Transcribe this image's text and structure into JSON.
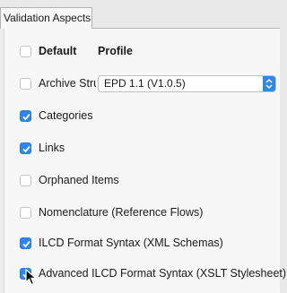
{
  "tab": {
    "label": "Validation Aspects"
  },
  "header": {
    "default_label": "Default",
    "profile_label": "Profile"
  },
  "profile_select": {
    "value": "EPD 1.1 (V1.0.5)",
    "icon": "stepper-arrows-icon"
  },
  "rows": [
    {
      "label": "Archive Structure",
      "checked": false
    },
    {
      "label": "Categories",
      "checked": true
    },
    {
      "label": "Links",
      "checked": true
    },
    {
      "label": "Orphaned Items",
      "checked": false
    },
    {
      "label": "Nomenclature (Reference Flows)",
      "checked": false
    },
    {
      "label": "ILCD Format Syntax (XML Schemas)",
      "checked": true
    },
    {
      "label": "Advanced ILCD Format Syntax (XSLT Stylesheet)",
      "checked": true
    }
  ],
  "colors": {
    "accent": "#2f86ec",
    "panel": "#f7f7f7"
  }
}
